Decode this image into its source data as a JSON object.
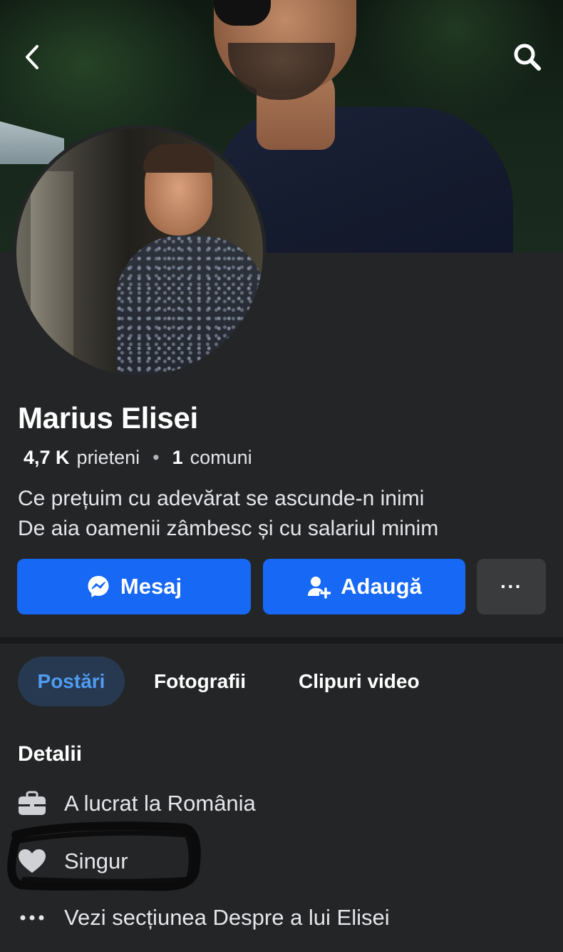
{
  "profile": {
    "name": "Marius Elisei",
    "friends_count": "4,7 K",
    "friends_label": "prieteni",
    "separator": "•",
    "mutual_count": "1",
    "mutual_label": "comuni",
    "bio_line1": "Ce prețuim cu adevărat se ascunde-n inimi",
    "bio_line2": "De aia oamenii zâmbesc și cu salariul minim"
  },
  "actions": {
    "message_label": "Mesaj",
    "add_label": "Adaugă",
    "more_label": "···"
  },
  "tabs": [
    {
      "label": "Postări",
      "active": true
    },
    {
      "label": "Fotografii",
      "active": false
    },
    {
      "label": "Clipuri video",
      "active": false
    }
  ],
  "details": {
    "title": "Detalii",
    "items": [
      {
        "icon": "briefcase-icon",
        "text": "A lucrat la România"
      },
      {
        "icon": "heart-icon",
        "text": "Singur"
      },
      {
        "icon": "more-dots-icon",
        "text": "Vezi secțiunea Despre a lui Elisei"
      }
    ]
  },
  "colors": {
    "background": "#242526",
    "primary_button": "#1668f5",
    "active_tab_bg": "#263951",
    "active_tab_text": "#4f9cf2",
    "scribble": "#0b0b0c"
  }
}
